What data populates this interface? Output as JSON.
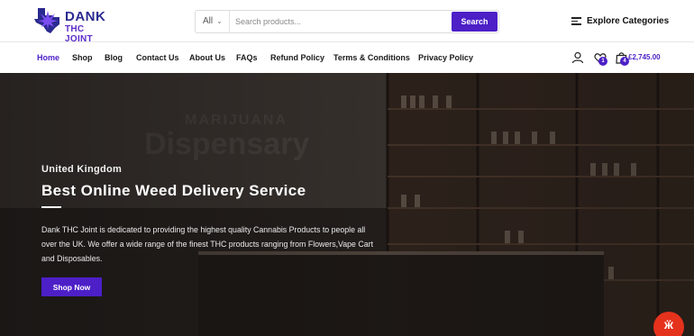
{
  "logo": {
    "line1": "DANK",
    "line2": "THC JOINT",
    "icon": "texas-cannabis-leaf-logo"
  },
  "search": {
    "category_value": "All",
    "placeholder": "Search products...",
    "button_label": "Search"
  },
  "explore": {
    "label": "Explore Categories",
    "icon": "menu-icon"
  },
  "nav": {
    "items": [
      {
        "label": "Home",
        "active": true
      },
      {
        "label": "Shop"
      },
      {
        "label": "Blog"
      },
      {
        "label": "Contact Us"
      },
      {
        "label": "About Us"
      },
      {
        "label": "FAQs"
      },
      {
        "label": "Refund Policy"
      },
      {
        "label": "Terms & Conditions"
      },
      {
        "label": "Privacy Policy"
      }
    ]
  },
  "header_icons": {
    "account_icon": "user-icon",
    "wishlist_icon": "heart-icon",
    "wishlist_count": "1",
    "cart_icon": "shopping-bag-icon",
    "cart_count": "4",
    "cart_total": "£2,745.00"
  },
  "hero": {
    "subtitle": "United Kingdom",
    "title": "Best Online Weed Delivery Service",
    "text": "Dank THC Joint is dedicated to providing the highest quality Cannabis  Products to people all over the UK. We offer a wide range of the finest THC  products ranging from Flowers,Vape Cart and Disposables.",
    "button_label": "Shop Now",
    "background_sign": "MARIJUANA Dispensary"
  },
  "colors": {
    "accent": "#4c1fc7",
    "logo_dark": "#2a2a8f",
    "chat": "#e5321d"
  }
}
